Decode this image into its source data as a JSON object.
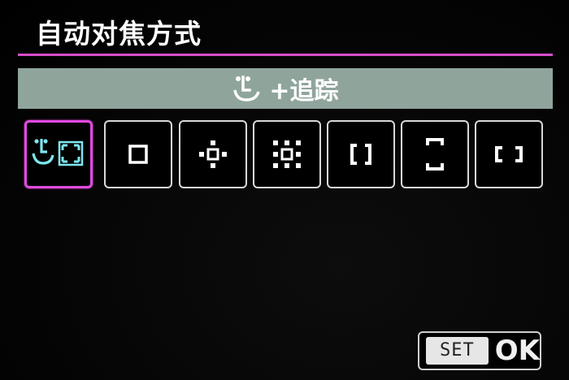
{
  "screen": {
    "title": "自动对焦方式",
    "accent_color": "#d64ecb",
    "banner_color": "#8fa59c"
  },
  "selected_mode": {
    "label": "+追踪",
    "icon": "face-tracking-icon"
  },
  "af_options": [
    {
      "icon": "face-tracking-af-icon",
      "selected": true
    },
    {
      "icon": "spot-af-icon",
      "selected": false
    },
    {
      "icon": "expand-af-area-cross-icon",
      "selected": false
    },
    {
      "icon": "expand-af-area-around-icon",
      "selected": false
    },
    {
      "icon": "flexible-zone-af-small-icon",
      "selected": false
    },
    {
      "icon": "flexible-zone-af-vertical-icon",
      "selected": false
    },
    {
      "icon": "flexible-zone-af-horizontal-icon",
      "selected": false
    }
  ],
  "footer": {
    "set_label": "SET",
    "ok_label": "OK"
  }
}
